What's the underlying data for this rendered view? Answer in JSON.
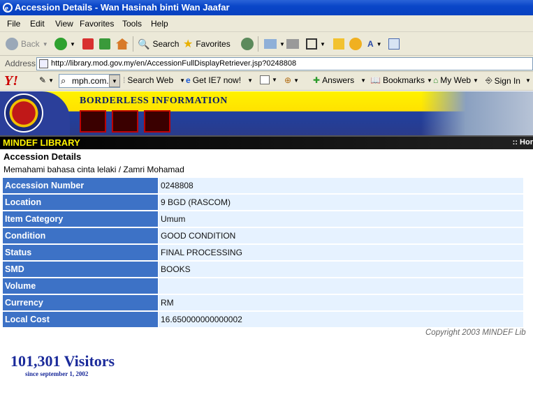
{
  "window": {
    "title": "Accession Details - Wan Hasinah binti Wan Jaafar"
  },
  "menu": [
    "File",
    "Edit",
    "View",
    "Favorites",
    "Tools",
    "Help"
  ],
  "toolbar": {
    "back_label": "Back",
    "search_label": "Search",
    "favorites_label": "Favorites"
  },
  "address": {
    "label": "Address",
    "url": "http://library.mod.gov.my/en/AccessionFullDisplayRetriever.jsp?0248808"
  },
  "yahoo": {
    "search_value": "mph.com.",
    "search_web": "Search Web",
    "get_ie7": "Get IE7 now!",
    "answers": "Answers",
    "bookmarks": "Bookmarks",
    "my_web": "My Web",
    "sign_in": "Sign In"
  },
  "banner": {
    "title": "BORDERLESS INFORMATION",
    "library": "MINDEF LIBRARY",
    "home_link": ":: Hor"
  },
  "page": {
    "heading": "Accession Details",
    "subtitle": "Memahami bahasa cinta lelaki / Zamri Mohamad",
    "rows": [
      {
        "label": "Accession Number",
        "value": "0248808"
      },
      {
        "label": "Location",
        "value": "9 BGD (RASCOM)"
      },
      {
        "label": "Item Category",
        "value": "Umum"
      },
      {
        "label": "Condition",
        "value": "GOOD CONDITION"
      },
      {
        "label": "Status",
        "value": "FINAL PROCESSING"
      },
      {
        "label": "SMD",
        "value": "BOOKS"
      },
      {
        "label": "Volume",
        "value": ""
      },
      {
        "label": "Currency",
        "value": "RM"
      },
      {
        "label": "Local Cost",
        "value": "16.650000000000002"
      }
    ],
    "copyright": "Copyright  2003 MINDEF Lib",
    "visitors": "101,301 Visitors",
    "since": "since september 1, 2002"
  },
  "colors": {
    "title_bar": "#0a46c8",
    "label_cell": "#3d72c6",
    "value_cell": "#e6f2ff",
    "banner_yellow": "#fff200"
  }
}
